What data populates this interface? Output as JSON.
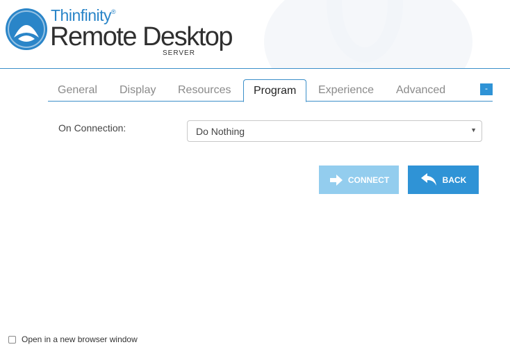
{
  "brand": {
    "name_top": "Thinfinity",
    "registered": "®",
    "name_main": "Remote Desktop",
    "name_sub": "SERVER"
  },
  "tabs": [
    {
      "label": "General",
      "active": false
    },
    {
      "label": "Display",
      "active": false
    },
    {
      "label": "Resources",
      "active": false
    },
    {
      "label": "Program",
      "active": true
    },
    {
      "label": "Experience",
      "active": false
    },
    {
      "label": "Advanced",
      "active": false
    }
  ],
  "collapse_label": "-",
  "form": {
    "on_connection_label": "On Connection:",
    "on_connection_value": "Do Nothing",
    "caret": "▼"
  },
  "buttons": {
    "connect": "CONNECT",
    "back": "BACK"
  },
  "footer": {
    "new_window_label": "Open in a new browser window",
    "new_window_checked": false
  },
  "colors": {
    "accent": "#2f93d6",
    "accent_disabled": "#93cdee",
    "divider": "#3b8fc9"
  }
}
